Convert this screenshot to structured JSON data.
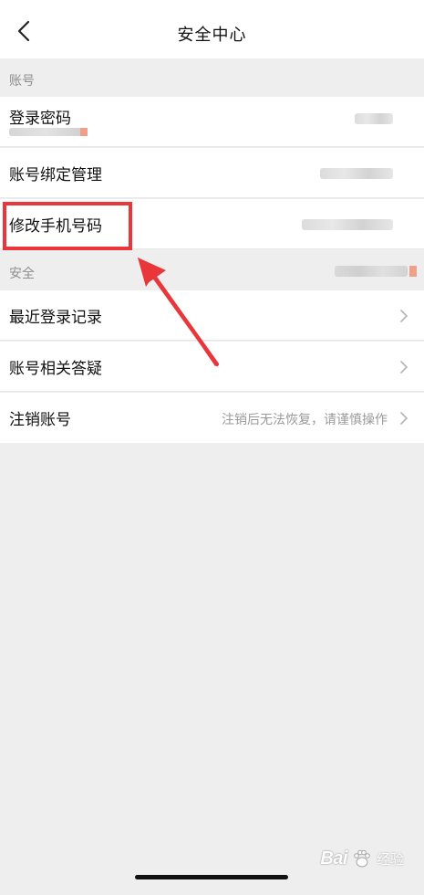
{
  "header": {
    "title": "安全中心"
  },
  "sections": {
    "account": "账号",
    "security": "安全"
  },
  "rows": {
    "login_password": "登录密码",
    "account_binding": "账号绑定管理",
    "change_phone": "修改手机号码",
    "recent_login": "最近登录记录",
    "account_faq": "账号相关答疑",
    "cancel_account": "注销账号",
    "cancel_account_hint": "注销后无法恢复，请谨慎操作"
  },
  "watermark": {
    "brand": "Bai",
    "suffix": "经验"
  },
  "icons": {
    "back": "back-chevron-icon",
    "row_chevron": "chevron-right-icon",
    "paw": "baidu-paw-icon"
  },
  "colors": {
    "background": "#efeeee",
    "highlight": "#e8363a",
    "chevron": "#b5b5b5"
  }
}
